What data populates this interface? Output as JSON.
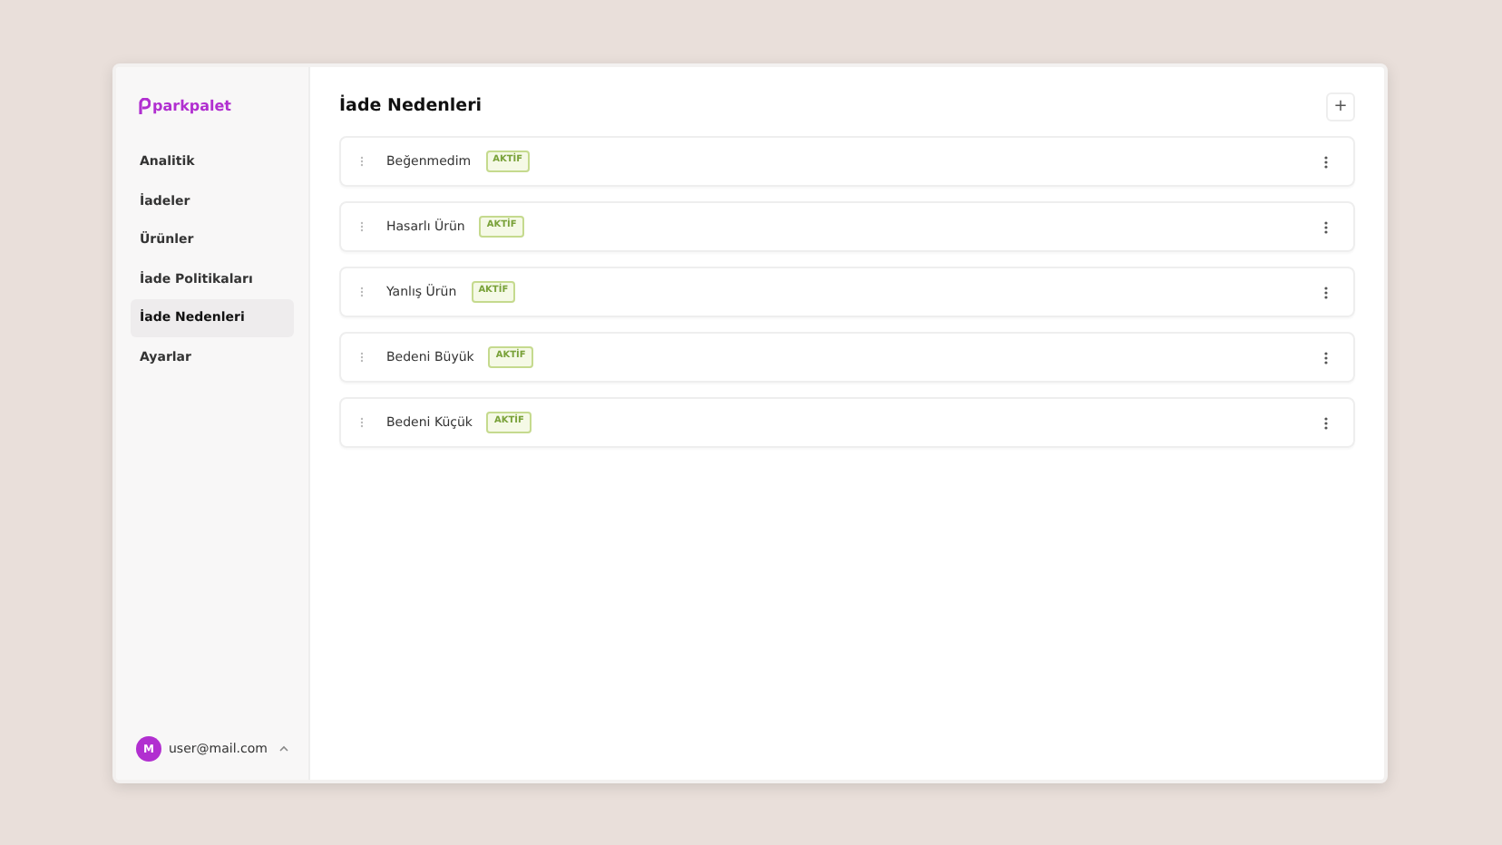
{
  "sidebar": {
    "logo": "parkpalet",
    "items": [
      {
        "label": "Analitik",
        "selected": false
      },
      {
        "label": "İadeler",
        "selected": false
      },
      {
        "label": "Ürünler",
        "selected": false
      },
      {
        "label": "İade Politikaları",
        "selected": false
      },
      {
        "label": "İade Nedenleri",
        "selected": true
      },
      {
        "label": "Ayarlar",
        "selected": false
      }
    ],
    "user": {
      "initial": "M",
      "email": "user@mail.com"
    }
  },
  "main": {
    "title": "İade Nedenleri",
    "add_button": "+",
    "reasons": [
      {
        "name": "Beğenmedim",
        "status": "AKTİF"
      },
      {
        "name": "Hasarlı Ürün",
        "status": "AKTİF"
      },
      {
        "name": "Yanlış Ürün",
        "status": "AKTİF"
      },
      {
        "name": "Bedeni Büyük",
        "status": "AKTİF"
      },
      {
        "name": "Bedeni Küçük",
        "status": "AKTİF"
      }
    ]
  }
}
